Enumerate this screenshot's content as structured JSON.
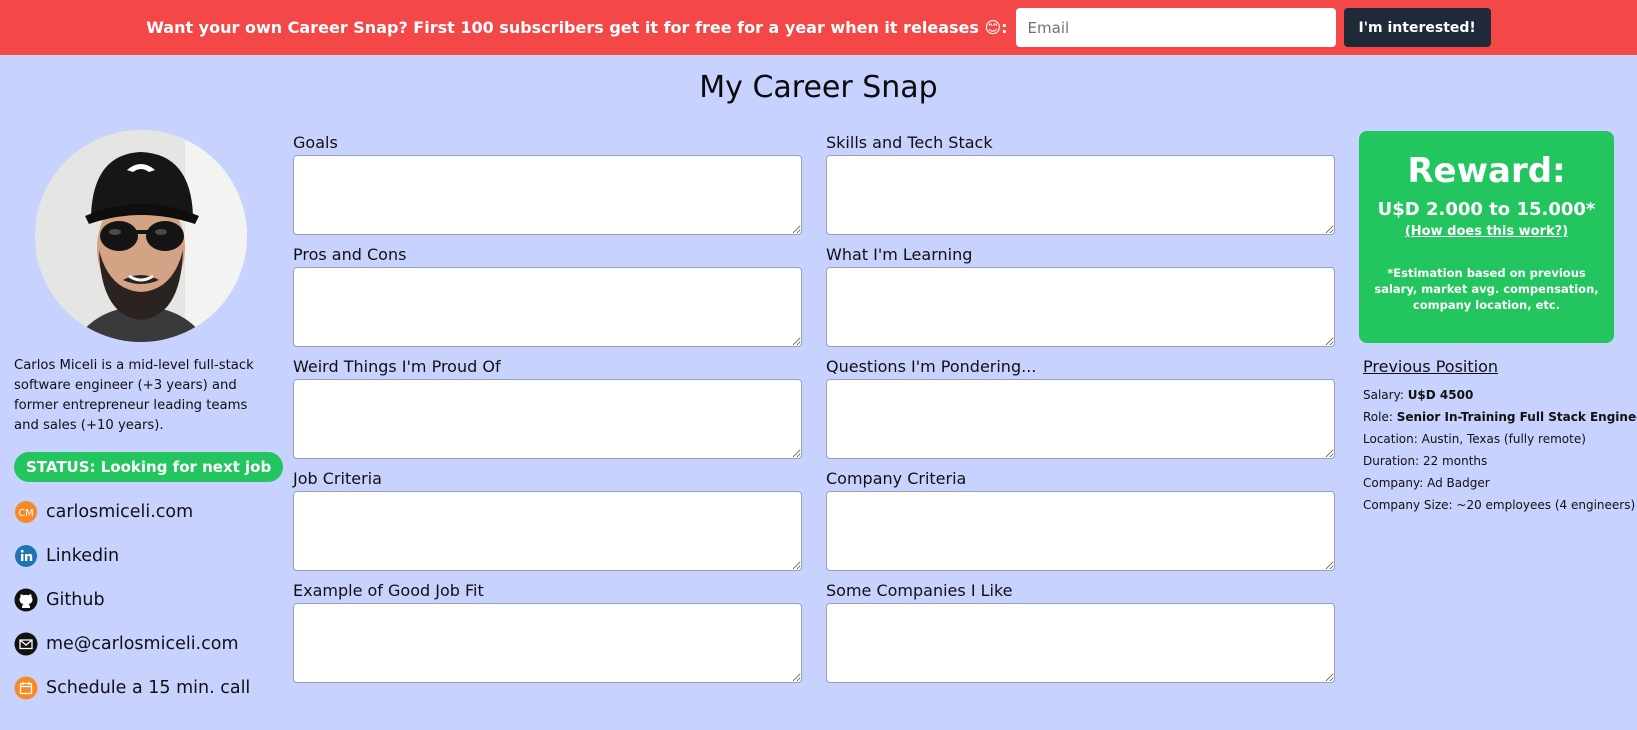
{
  "banner": {
    "text": "Want your own Career Snap? First 100 subscribers get it for free for a year when it releases 😊:",
    "email_placeholder": "Email",
    "button_label": "I'm interested!"
  },
  "page_title": "My Career Snap",
  "profile": {
    "bio": "Carlos Miceli is a mid-level full-stack software engineer (+3 years) and former entrepreneur leading teams and sales (+10 years).",
    "status": "STATUS: Looking for next job",
    "links": [
      {
        "label": "carlosmiceli.com",
        "icon": "cm-logo-icon"
      },
      {
        "label": "Linkedin",
        "icon": "linkedin-icon"
      },
      {
        "label": "Github",
        "icon": "github-icon"
      },
      {
        "label": "me@carlosmiceli.com",
        "icon": "mail-icon"
      },
      {
        "label": "Schedule a 15 min. call",
        "icon": "calendar-icon"
      }
    ]
  },
  "fields": {
    "goals": "Goals",
    "skills": "Skills and Tech Stack",
    "pros_cons": "Pros and Cons",
    "learning": "What I'm Learning",
    "weird": "Weird Things I'm Proud Of",
    "questions": "Questions I'm Pondering...",
    "job_criteria": "Job Criteria",
    "company_criteria": "Company Criteria",
    "job_fit": "Example of Good Job Fit",
    "companies": "Some Companies I Like"
  },
  "reward": {
    "title": "Reward:",
    "amount": "U$D 2.000 to 15.000*",
    "link": "(How does this work?)",
    "note": "*Estimation based on previous salary, market avg. compensation, company location, etc."
  },
  "previous": {
    "title": "Previous Position",
    "salary_label": "Salary:",
    "salary": "U$D 4500",
    "role_label": "Role:",
    "role": "Senior In-Training Full Stack Engineer",
    "location": "Location: Austin, Texas (fully remote)",
    "duration": "Duration: 22 months",
    "company": "Company: Ad Badger",
    "size": "Company Size: ~20 employees (4 engineers)"
  },
  "colors": {
    "banner": "#f34748",
    "background": "#c7d2fe",
    "accent_green": "#22c55e",
    "button_dark": "#1f2937"
  }
}
